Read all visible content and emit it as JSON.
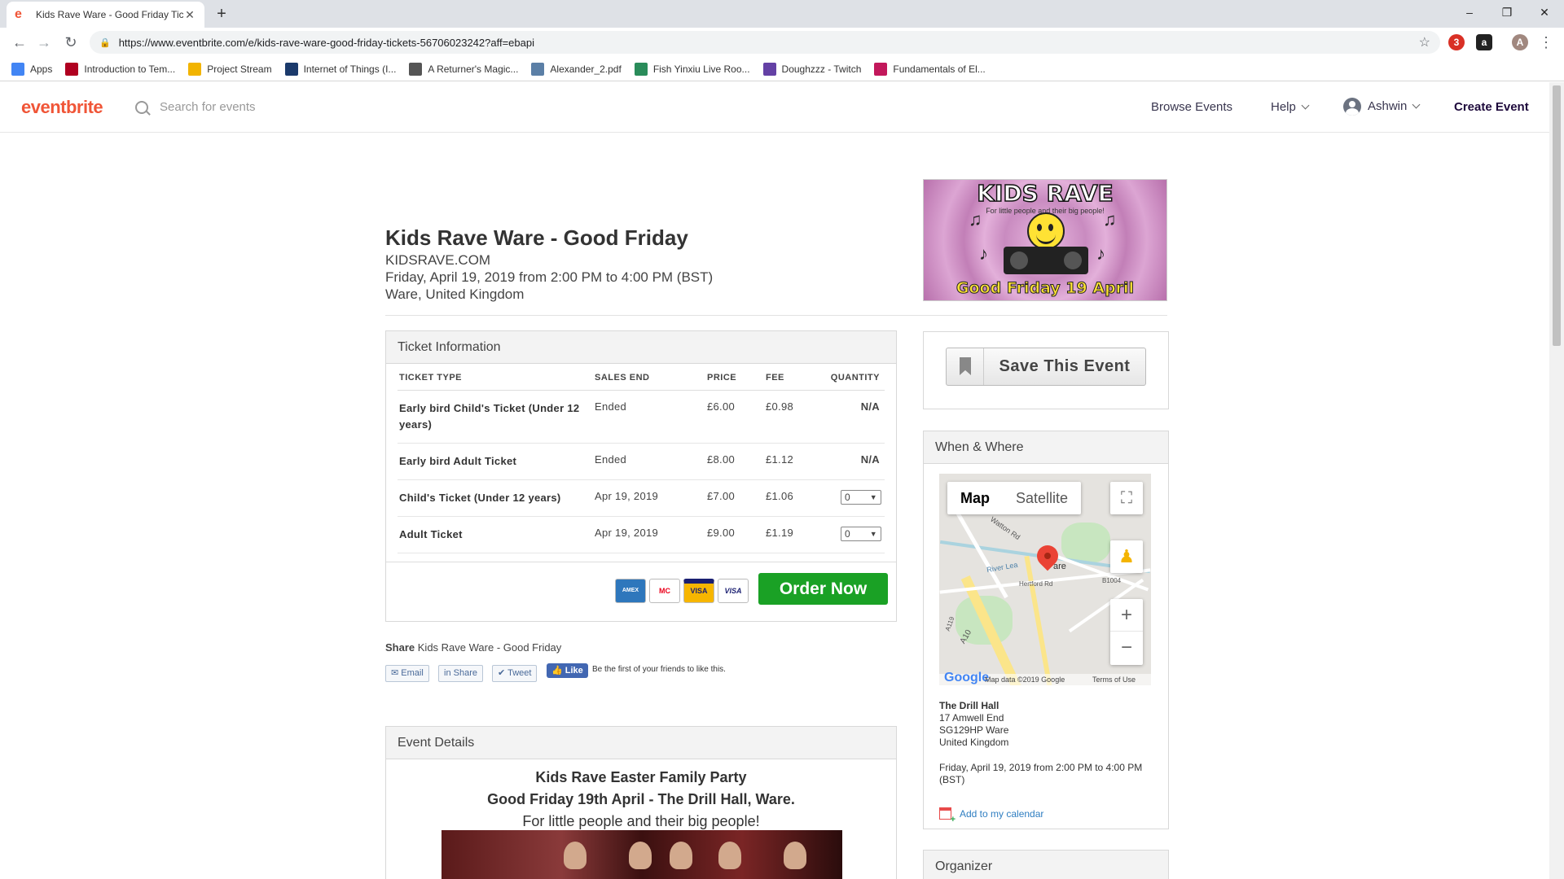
{
  "browser": {
    "tab_title": "Kids Rave Ware - Good Friday Tic",
    "tab_favicon": "e",
    "new_tab": "+",
    "url": "https://www.eventbrite.com/e/kids-rave-ware-good-friday-tickets-56706023242?aff=ebapi",
    "profile_initial": "A",
    "window_controls": [
      "–",
      "❐",
      "✕"
    ],
    "extension_badge": "3"
  },
  "bookmarks": [
    {
      "label": "Apps",
      "color": "#4285f4"
    },
    {
      "label": "Introduction to Tem...",
      "color": "#b00020"
    },
    {
      "label": "Project Stream",
      "color": "#f2b400"
    },
    {
      "label": "Internet of Things (I...",
      "color": "#1b3a6b"
    },
    {
      "label": "A Returner's Magic...",
      "color": "#555555"
    },
    {
      "label": "Alexander_2.pdf",
      "color": "#5b7fa6"
    },
    {
      "label": "Fish Yinxiu Live Roo...",
      "color": "#2a8c5a"
    },
    {
      "label": "Doughzzz - Twitch",
      "color": "#6441a5"
    },
    {
      "label": "Fundamentals of El...",
      "color": "#c2185b"
    }
  ],
  "header": {
    "logo": "eventbrite",
    "search_placeholder": "Search for events",
    "browse": "Browse Events",
    "help": "Help",
    "user": "Ashwin",
    "create": "Create Event"
  },
  "event": {
    "title": "Kids Rave Ware - Good Friday",
    "organizer_line": "KIDSRAVE.COM",
    "datetime": "Friday, April 19, 2019 from 2:00 PM to 4:00 PM (BST)",
    "location": "Ware, United Kingdom",
    "hero": {
      "title": "KIDS RAVE",
      "tagline": "For little people and their big people!",
      "date": "Good Friday 19 April"
    }
  },
  "tickets": {
    "panel_title": "Ticket Information",
    "columns": [
      "TICKET TYPE",
      "SALES END",
      "PRICE",
      "FEE",
      "QUANTITY"
    ],
    "rows": [
      {
        "type": "Early bird Child's Ticket (Under 12 years)",
        "sales_end": "Ended",
        "price": "£6.00",
        "fee": "£0.98",
        "quantity": "N/A"
      },
      {
        "type": "Early bird Adult Ticket",
        "sales_end": "Ended",
        "price": "£8.00",
        "fee": "£1.12",
        "quantity": "N/A"
      },
      {
        "type": "Child's Ticket (Under 12 years)",
        "sales_end": "Apr 19, 2019",
        "price": "£7.00",
        "fee": "£1.06",
        "quantity": "0"
      },
      {
        "type": "Adult Ticket",
        "sales_end": "Apr 19, 2019",
        "price": "£9.00",
        "fee": "£1.19",
        "quantity": "0"
      }
    ],
    "cards": [
      "AMEX",
      "MC",
      "VISA",
      "VISA"
    ],
    "order_button": "Order Now"
  },
  "share": {
    "label": "Share",
    "text": "Kids Rave Ware - Good Friday",
    "email": "Email",
    "share": "Share",
    "tweet": "Tweet",
    "like": "Like",
    "like_text": "Be the first of your friends to like this."
  },
  "details": {
    "panel_title": "Event Details",
    "line1": "Kids Rave Easter Family Party",
    "line2": "Good Friday 19th April - The Drill Hall, Ware.",
    "line3": "For little people and their big people!"
  },
  "sidebar": {
    "save_label": "Save This Event",
    "when_where_title": "When & Where",
    "map": {
      "map_tab": "Map",
      "satellite_tab": "Satellite",
      "zoom_in": "+",
      "zoom_out": "−",
      "place_label": "are",
      "road_labels": [
        "Watton Rd",
        "River Lea",
        "Hertford Rd",
        "B1004",
        "A119",
        "A10"
      ],
      "google": "Google",
      "attribution": "Map data ©2019 Google",
      "terms": "Terms of Use"
    },
    "venue_name": "The Drill Hall",
    "address1": "17 Amwell End",
    "address2": "SG129HP Ware",
    "country": "United Kingdom",
    "datetime": "Friday, April 19, 2019 from 2:00 PM to 4:00 PM (BST)",
    "calendar_link": "Add to my calendar",
    "organizer_title": "Organizer"
  }
}
